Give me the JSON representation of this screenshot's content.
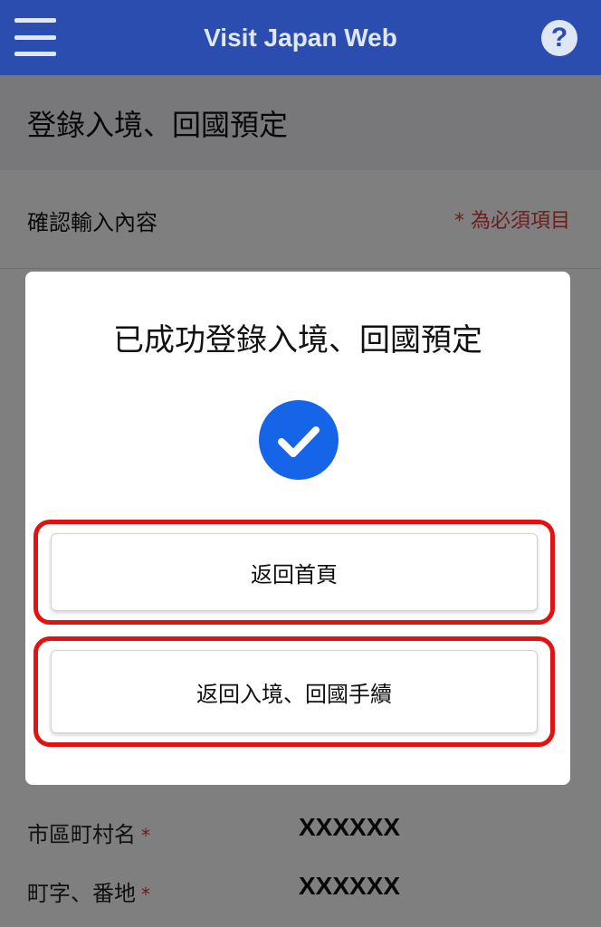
{
  "header": {
    "app_title": "Visit Japan Web",
    "help_label": "?"
  },
  "page": {
    "title": "登錄入境、回國預定",
    "section_title": "確認輸入內容",
    "required_note": "* 為必須項目",
    "fields": [
      {
        "label": "市區町村名",
        "required_mark": "*",
        "value": "XXXXXX"
      },
      {
        "label": "町字、番地",
        "required_mark": "*",
        "value": "XXXXXX"
      }
    ]
  },
  "modal": {
    "title": "已成功登錄入境、回國預定",
    "success_icon": "check-circle-icon",
    "accent_color": "#1665e8",
    "highlight_color": "#e41111",
    "buttons": {
      "home_label": "返回首頁",
      "procedures_label": "返回入境、回國手續"
    }
  },
  "colors": {
    "header_bg": "#2a4daf",
    "required_text": "#d93a3a"
  }
}
